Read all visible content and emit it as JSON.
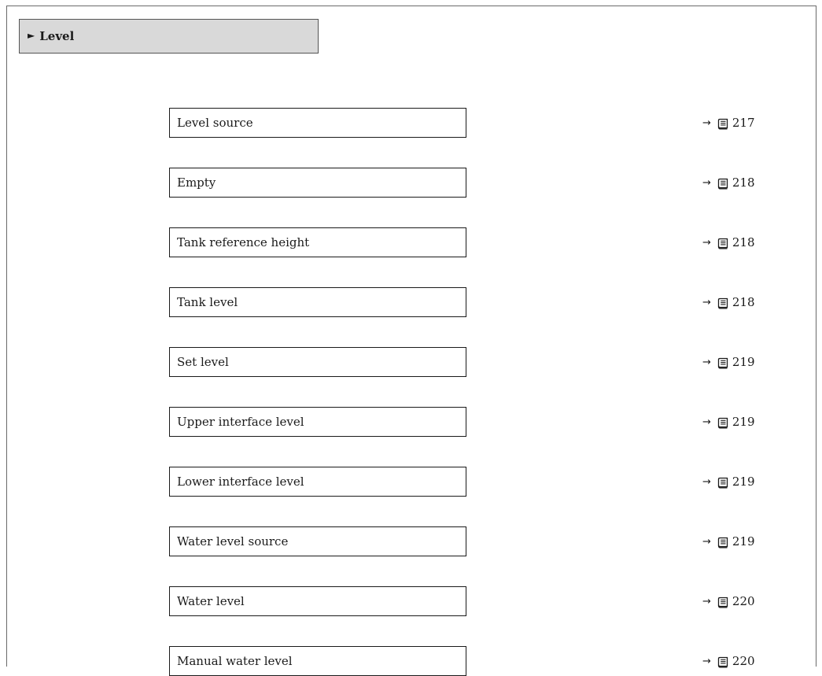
{
  "submenu": {
    "marker": "►",
    "title": "Level"
  },
  "parameters": [
    {
      "label": "Level source",
      "arrow": "→",
      "page": "217"
    },
    {
      "label": "Empty",
      "arrow": "→",
      "page": "218"
    },
    {
      "label": "Tank reference height",
      "arrow": "→",
      "page": "218"
    },
    {
      "label": "Tank level",
      "arrow": "→",
      "page": "218"
    },
    {
      "label": "Set level",
      "arrow": "→",
      "page": "219"
    },
    {
      "label": "Upper interface level",
      "arrow": "→",
      "page": "219"
    },
    {
      "label": "Lower interface level",
      "arrow": "→",
      "page": "219"
    },
    {
      "label": "Water level source",
      "arrow": "→",
      "page": "219"
    },
    {
      "label": "Water level",
      "arrow": "→",
      "page": "220"
    },
    {
      "label": "Manual water level",
      "arrow": "→",
      "page": "220"
    }
  ],
  "icons": {
    "page_reference": "page-book-icon"
  }
}
